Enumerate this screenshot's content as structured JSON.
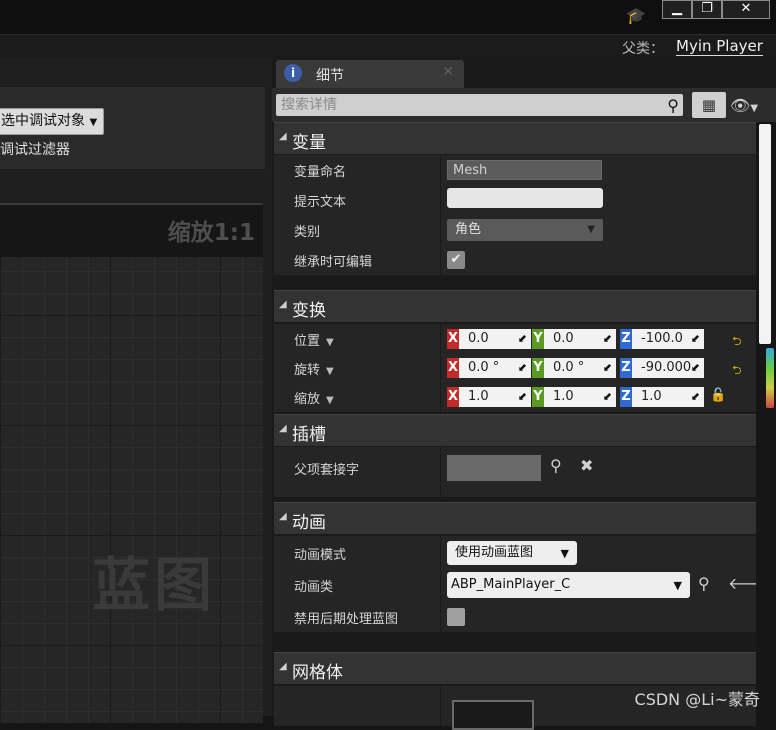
{
  "window": {
    "minimize": "▁",
    "restore": "❐",
    "close": "✕",
    "cap_icon": "graduation-cap-icon"
  },
  "parent": {
    "label": "父类：",
    "value": "Myin Player"
  },
  "left": {
    "debug_dropdown": "选中调试对象",
    "debug_filter": "调试过滤器",
    "zoom": "缩放1:1",
    "watermark": "蓝图"
  },
  "details": {
    "tab_label": "细节",
    "search_placeholder": "搜索详情",
    "categories": {
      "variable": "变量",
      "transform": "变换",
      "socket": "插槽",
      "animation": "动画",
      "mesh": "网格体"
    },
    "variable": {
      "name_label": "变量命名",
      "name_value": "Mesh",
      "tooltip_label": "提示文本",
      "tooltip_value": "",
      "category_label": "类别",
      "category_value": "角色",
      "editable_label": "继承时可编辑",
      "editable_checked": true
    },
    "transform": {
      "location_label": "位置",
      "location": {
        "x": "0.0",
        "y": "0.0",
        "z": "-100.0"
      },
      "rotation_label": "旋转",
      "rotation": {
        "x": "0.0 °",
        "y": "0.0 °",
        "z": "-90.000"
      },
      "scale_label": "缩放",
      "scale": {
        "x": "1.0",
        "y": "1.0",
        "z": "1.0"
      }
    },
    "socket": {
      "parent_socket_label": "父项套接字",
      "parent_socket_value": ""
    },
    "animation": {
      "mode_label": "动画模式",
      "mode_value": "使用动画蓝图",
      "class_label": "动画类",
      "class_value": "ABP_MainPlayer_C",
      "disable_post_label": "禁用后期处理蓝图",
      "disable_post_checked": false
    }
  },
  "watermark_credit": "CSDN @Li~蒙奇",
  "colors": {
    "axis_x": "#c52a2a",
    "axis_y": "#5a9a22",
    "axis_z": "#2e6ad1",
    "reset": "#d1b000"
  }
}
